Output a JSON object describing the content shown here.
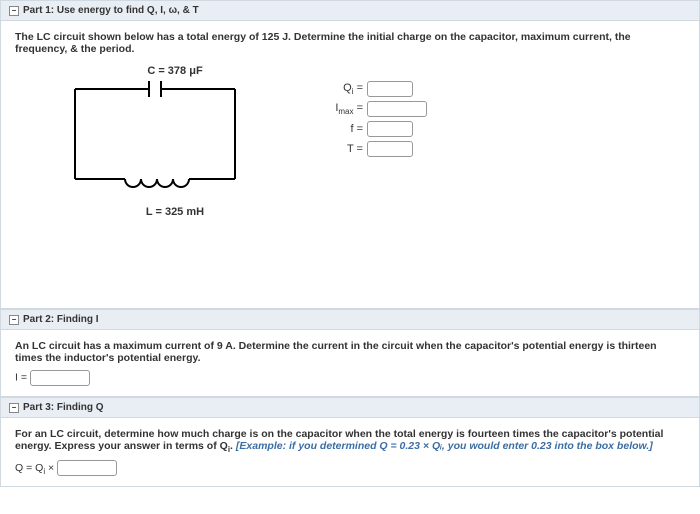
{
  "collapse_glyph": "−",
  "part1": {
    "title": "Part 1: Use energy to find Q, I, ω, & T",
    "prompt": "The LC circuit shown below has a total energy of 125 J. Determine the initial charge on the capacitor, maximum current, the frequency, & the period.",
    "C_label": "C = 378 μF",
    "L_label": "L = 325 mH",
    "inputs": {
      "Qi": {
        "label_pre": "Q",
        "label_sub": "i",
        "label_post": " ="
      },
      "Imax": {
        "label_pre": "I",
        "label_sub": "max",
        "label_post": " ="
      },
      "f": {
        "label": "f ="
      },
      "T": {
        "label": "T ="
      }
    }
  },
  "part2": {
    "title": "Part 2: Finding I",
    "prompt": "An LC circuit has a maximum current of 9 A. Determine the current in the circuit when the capacitor's potential energy is thirteen times the inductor's potential energy.",
    "input_label": "I ="
  },
  "part3": {
    "title": "Part 3: Finding Q",
    "prompt_a": "For an LC circuit, determine how much charge is on the capacitor when the total energy is fourteen times the capacitor's potential energy. Express your answer in terms of Q",
    "prompt_sub": "i",
    "prompt_b": ". ",
    "example": "[Example: if you determined Q = 0.23 × Qᵢ, you would enter 0.23 into the box below.]",
    "input_pre": "Q = Q",
    "input_sub": "i",
    "input_post": " ×"
  }
}
